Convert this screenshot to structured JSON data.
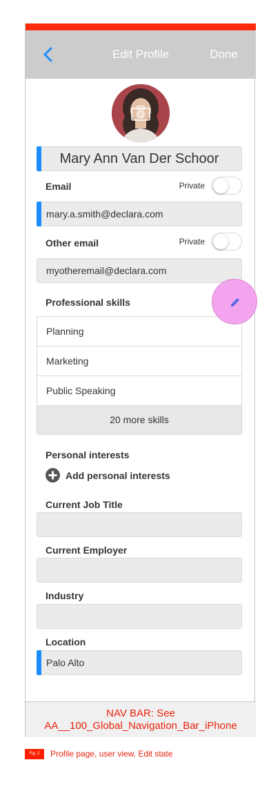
{
  "header": {
    "title": "Edit Profile",
    "done_label": "Done",
    "accent_color": "#ff2a0b",
    "background_color": "#cccccc"
  },
  "profile": {
    "name": "Mary Ann Van Der Schoor"
  },
  "email": {
    "label": "Email",
    "private_label": "Private",
    "value": "mary.a.smith@declara.com"
  },
  "other_email": {
    "label": "Other email",
    "private_label": "Private",
    "value": "myotheremail@declara.com"
  },
  "skills": {
    "label": "Professional skills",
    "items": [
      "Planning",
      "Marketing",
      "Public Speaking"
    ],
    "more_label": "20 more skills"
  },
  "interests": {
    "label": "Personal interests",
    "add_label": "Add personal interests"
  },
  "job_title": {
    "label": "Current Job Title",
    "value": ""
  },
  "employer": {
    "label": "Current Employer",
    "value": ""
  },
  "industry": {
    "label": "Industry",
    "value": ""
  },
  "location": {
    "label": "Location",
    "value": "Palo Alto"
  },
  "nav_bar": {
    "line1": "NAV BAR: See",
    "line2": "AA__100_Global_Navigation_Bar_iPhone"
  },
  "figure": {
    "tag": "Fig. 2",
    "caption": "Profile page, user view. Edit state"
  },
  "icons": {
    "back": "chevron-left-icon",
    "camera": "camera-icon",
    "edit": "pencil-icon",
    "add": "plus-circle-icon"
  },
  "colors": {
    "focus_accent": "#1a8cff",
    "annotation_red": "#e8210c",
    "edit_button": "#f2a5ee"
  }
}
